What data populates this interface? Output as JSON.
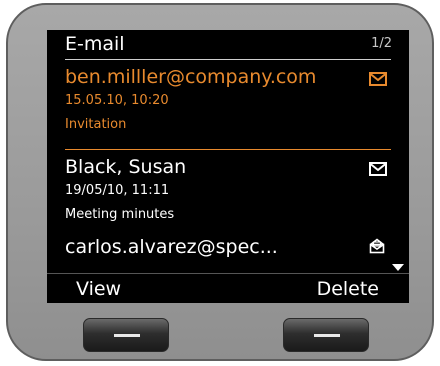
{
  "header": {
    "title": "E-mail",
    "page_indicator": "1/2"
  },
  "messages": [
    {
      "address": "ben.milller@company.com",
      "datetime": "15.05.10, 10:20",
      "subject": "Invitation",
      "icon": "envelope-icon",
      "selected": true
    },
    {
      "address": "Black, Susan",
      "datetime": "19/05/10, 11:11",
      "subject": "Meeting minutes",
      "icon": "envelope-icon",
      "selected": false
    },
    {
      "address": "carlos.alvarez@spec...",
      "icon": "opened-envelope-icon",
      "selected": false
    }
  ],
  "softkeys": {
    "left": "View",
    "right": "Delete"
  },
  "colors": {
    "accent": "#e88a2e",
    "screen_bg": "#000000",
    "text": "#ffffff",
    "casing": "#9c9c9c"
  }
}
